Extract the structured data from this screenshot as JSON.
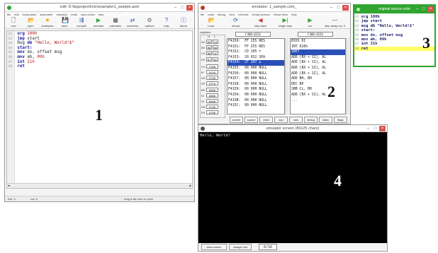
{
  "editor": {
    "title": "edit: D:\\Epproject\\mic\\example\\1_sample.asm",
    "menu": [
      "file",
      "edit",
      "bookmarks",
      "assembler",
      "emulator",
      "math",
      "ascii codes",
      "help"
    ],
    "toolbar": [
      {
        "label": "new",
        "icon": "new-file-icon"
      },
      {
        "label": "open",
        "icon": "open-folder-icon"
      },
      {
        "label": "examples",
        "icon": "star-icon"
      },
      {
        "label": "save",
        "icon": "save-disk-icon"
      },
      {
        "label": "compile",
        "icon": "compile-icon"
      },
      {
        "label": "emulate",
        "icon": "play-icon"
      },
      {
        "label": "calculator",
        "icon": "calculator-icon"
      },
      {
        "label": "convertor",
        "icon": "convertor-icon"
      },
      {
        "label": "options",
        "icon": "gears-icon"
      },
      {
        "label": "help",
        "icon": "help-icon"
      },
      {
        "label": "about",
        "icon": "about-icon"
      }
    ],
    "code_lines": [
      {
        "n": "01",
        "parts": [
          {
            "t": "org ",
            "c": "kw"
          },
          {
            "t": "100h",
            "c": "num"
          }
        ]
      },
      {
        "n": "02",
        "parts": [
          {
            "t": "jmp ",
            "c": "kw"
          },
          {
            "t": "start",
            "c": ""
          }
        ]
      },
      {
        "n": "03",
        "parts": [
          {
            "t": "msg ",
            "c": ""
          },
          {
            "t": "db ",
            "c": "kw"
          },
          {
            "t": "\"Hello, World!$\"",
            "c": "str"
          }
        ]
      },
      {
        "n": "04",
        "parts": [
          {
            "t": "start:",
            "c": "lbl"
          }
        ]
      },
      {
        "n": "05",
        "parts": [
          {
            "t": "mov ",
            "c": "kw"
          },
          {
            "t": "dx, offset msg",
            "c": ""
          }
        ]
      },
      {
        "n": "06",
        "parts": [
          {
            "t": "mov ",
            "c": "kw"
          },
          {
            "t": "ah, ",
            "c": ""
          },
          {
            "t": "09h",
            "c": "num"
          }
        ]
      },
      {
        "n": "07",
        "parts": [
          {
            "t": "int ",
            "c": "kw"
          },
          {
            "t": "21h",
            "c": "num"
          }
        ]
      },
      {
        "n": "08",
        "parts": [
          {
            "t": "ret",
            "c": "kw"
          }
        ]
      }
    ],
    "status": {
      "line": "line: 4",
      "col": "col: 5",
      "hint": "drag a file here to open"
    },
    "panel_number": "1"
  },
  "emulator": {
    "title": "emulator: 1_sample.com_",
    "menu": [
      "file",
      "math",
      "debug",
      "view",
      "external",
      "virtual devices",
      "virtual drive",
      "help"
    ],
    "toolbar": [
      {
        "label": "Load",
        "icon": "load-icon"
      },
      {
        "label": "reload",
        "icon": "reload-icon"
      },
      {
        "label": "step back",
        "icon": "step-back-icon"
      },
      {
        "label": "single step",
        "icon": "single-step-icon"
      },
      {
        "label": "run",
        "icon": "run-icon"
      },
      {
        "label": "step delay ms: 0",
        "icon": "slider-icon"
      }
    ],
    "registers_label": "registers",
    "registers_header": [
      "H",
      "L"
    ],
    "registers": [
      {
        "name": "AX",
        "h": "09",
        "l": "24"
      },
      {
        "name": "BX",
        "h": "00",
        "l": "00"
      },
      {
        "name": "CX",
        "h": "00",
        "l": "1F"
      },
      {
        "name": "DX",
        "h": "01",
        "l": "02"
      }
    ],
    "segment_registers": [
      {
        "name": "CS",
        "v": "F400"
      },
      {
        "name": "IP",
        "v": "0154"
      },
      {
        "name": "SS",
        "v": "0700"
      },
      {
        "name": "SP",
        "v": "FFFA"
      },
      {
        "name": "BP",
        "v": "0000"
      },
      {
        "name": "SI",
        "v": "0000"
      },
      {
        "name": "DI",
        "v": "0000"
      },
      {
        "name": "DS",
        "v": "0700"
      },
      {
        "name": "ES",
        "v": "0700"
      }
    ],
    "memory_address": "F400:0154",
    "disasm_address": "F400:0154",
    "memory_rows": [
      "F4150:  FF 255 RES",
      "F4151:  FF 255 RES",
      "F4152:  CD 205 =",
      "F4153:  20 032 SPA",
      "F4154:  CF 207 ±",
      "F4155:  00 000 NULL",
      "F4156:  00 000 NULL",
      "F4157:  00 000 NULL",
      "F4158:  00 000 NULL",
      "F4159:  00 000 NULL",
      "F415A:  00 000 NULL",
      "F415B:  00 000 NULL",
      "F415C:  00 000 NULL"
    ],
    "memory_selected": 4,
    "disasm_rows": [
      "BIOS DI",
      "INT 020h",
      "IRET",
      "ADD [BX + SI], AL",
      "ADD [BX + SI], AL",
      "ADD [BX + SI], AL",
      "ADD [BX + SI], AL",
      "ADD BH, BH",
      "DEC BP",
      "SBB CL, BH",
      "ADD [BX + SI], AL",
      "..."
    ],
    "disasm_selected": 2,
    "bottom_buttons": [
      "screen",
      "source",
      "reset",
      "aux",
      "vars",
      "debug",
      "stack",
      "flags"
    ],
    "panel_number": "2"
  },
  "source": {
    "title": "original source code",
    "lines": [
      {
        "n": "01",
        "t": "org 100h"
      },
      {
        "n": "02",
        "t": "jmp start"
      },
      {
        "n": "03",
        "t": "msg db \"Hello, World!$\""
      },
      {
        "n": "04",
        "t": "start:"
      },
      {
        "n": "05",
        "t": "mov dx, offset msg"
      },
      {
        "n": "06",
        "t": "mov ah, 09h"
      },
      {
        "n": "07",
        "t": "int 21h"
      },
      {
        "n": "08",
        "t": "ret"
      }
    ],
    "highlight_line": 7,
    "panel_number": "3"
  },
  "screen": {
    "title": "emulator screen (80x25 chars)",
    "output": "Hello, World!",
    "buttons": [
      "clear screen",
      "change font"
    ],
    "counter": "0/16",
    "panel_number": "4"
  },
  "colors": {
    "accent_green": "#2fa52f",
    "selection_blue": "#2a4fb8",
    "highlight_yellow": "#ffff66",
    "close_red": "#d9534f"
  }
}
